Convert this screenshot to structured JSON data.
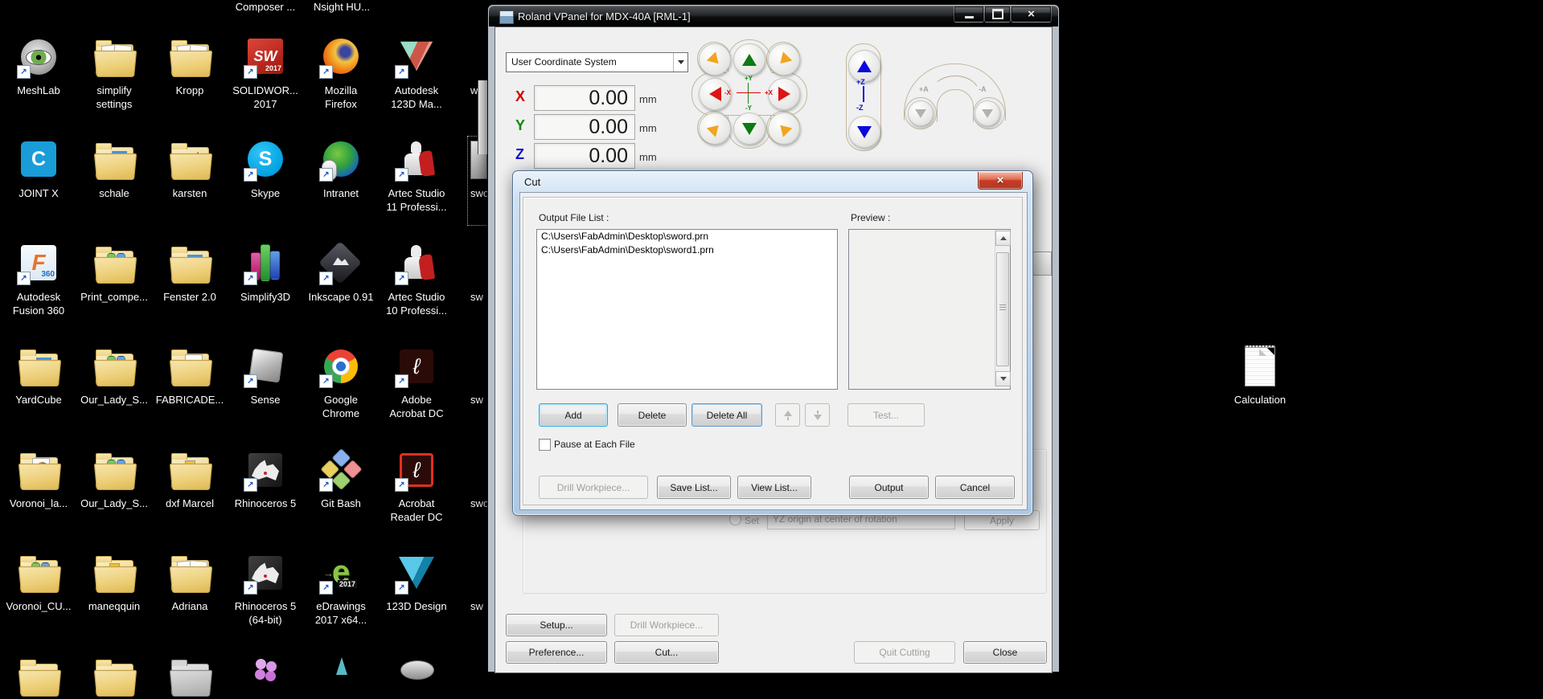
{
  "desktop": {
    "top_partial_labels": [
      "Composer ...",
      "Nsight HU..."
    ],
    "rows": [
      [
        {
          "label": "MeshLab",
          "type": "meshlab",
          "badge": true
        },
        {
          "label": "simplify\nsettings",
          "type": "folder-docs"
        },
        {
          "label": "Kropp",
          "type": "folder-docs"
        },
        {
          "label": "SOLIDWOR...\n2017",
          "type": "sw",
          "glyph": "SW",
          "badge_text": "2017",
          "badge": true
        },
        {
          "label": "Mozilla\nFirefox",
          "type": "firefox",
          "badge": true
        },
        {
          "label": "Autodesk\n123D Ma...",
          "type": "a123d",
          "badge": true
        }
      ],
      [
        {
          "label": "JOINT X",
          "type": "letter",
          "glyph": "C"
        },
        {
          "label": "schale",
          "type": "folder-blue"
        },
        {
          "label": "karsten",
          "type": "folder-red"
        },
        {
          "label": "Skype",
          "type": "circle-letter",
          "glyph": "S",
          "badge": true
        },
        {
          "label": "Intranet",
          "type": "globe",
          "badge": true
        },
        {
          "label": "Artec Studio\n11 Professi...",
          "type": "artec",
          "badge": true
        }
      ],
      [
        {
          "label": "Autodesk\nFusion 360",
          "type": "fusion",
          "glyph": "F",
          "badge_text": "360",
          "badge": true
        },
        {
          "label": "Print_compe...",
          "type": "folder-gb"
        },
        {
          "label": "Fenster 2.0",
          "type": "folder-blue"
        },
        {
          "label": "Simplify3D",
          "type": "s3d",
          "badge": true
        },
        {
          "label": "Inkscape 0.91",
          "type": "inkscape",
          "badge": true
        },
        {
          "label": "Artec Studio\n10 Professi...",
          "type": "artec",
          "badge": true
        }
      ],
      [
        {
          "label": "YardCube",
          "type": "folder-blue"
        },
        {
          "label": "Our_Lady_S...",
          "type": "folder-gb"
        },
        {
          "label": "FABRICADE...",
          "type": "folder-white"
        },
        {
          "label": "Sense",
          "type": "sense",
          "badge": true
        },
        {
          "label": "Google\nChrome",
          "type": "chrome",
          "badge": true
        },
        {
          "label": "Adobe\nAcrobat DC",
          "type": "acrobat",
          "badge": true
        }
      ],
      [
        {
          "label": "Voronoi_la...",
          "type": "folder-ff"
        },
        {
          "label": "Our_Lady_S...",
          "type": "folder-gb"
        },
        {
          "label": "dxf Marcel",
          "type": "folder-img"
        },
        {
          "label": "Rhinoceros 5",
          "type": "rhino",
          "badge": true
        },
        {
          "label": "Git Bash",
          "type": "git",
          "badge": true
        },
        {
          "label": "Acrobat\nReader DC",
          "type": "reader",
          "badge": true
        }
      ],
      [
        {
          "label": "Voronoi_CU...",
          "type": "folder-gb"
        },
        {
          "label": "maneqquin",
          "type": "folder-img"
        },
        {
          "label": "Adriana",
          "type": "folder-docs"
        },
        {
          "label": "Rhinoceros 5\n(64-bit)",
          "type": "rhino",
          "badge": true
        },
        {
          "label": "eDrawings\n2017 x64...",
          "type": "edraw",
          "glyph": "e",
          "badge_text": "2017",
          "badge": true
        },
        {
          "label": "123D Design",
          "type": "d123",
          "badge": true
        }
      ]
    ],
    "col7_partial_labels": [
      "wo",
      "swo",
      "sw",
      "sw",
      "swo",
      "sw"
    ],
    "bottom_partial_row": [
      "folder",
      "folder",
      "folder-grey",
      "flower",
      "drop",
      "bowl"
    ],
    "calculation_icon": {
      "label": "Calculation",
      "type": "doc"
    }
  },
  "vpanel": {
    "title": "Roland VPanel for MDX-40A [RML-1]",
    "coordinate_system": "User Coordinate System",
    "axes": [
      {
        "axis": "X",
        "value": "0.00",
        "unit": "mm",
        "color": "#d40000"
      },
      {
        "axis": "Y",
        "value": "0.00",
        "unit": "mm",
        "color": "#0a8a0a"
      },
      {
        "axis": "Z",
        "value": "0.00",
        "unit": "mm",
        "color": "#1212cc"
      }
    ],
    "jog": {
      "plus_y": "+Y",
      "minus_y": "-Y",
      "plus_x": "+X",
      "minus_x": "-X",
      "plus_z": "+Z",
      "minus_z": "-Z",
      "plus_a": "+A",
      "minus_a": "-A"
    },
    "set_row": {
      "radio_label": "Set",
      "dropdown_value": "YZ origin at center of rotation",
      "apply_label": "Apply"
    },
    "buttons": {
      "setup": "Setup...",
      "drill_workpiece": "Drill Workpiece...",
      "preference": "Preference...",
      "cut": "Cut...",
      "quit_cutting": "Quit Cutting",
      "close": "Close"
    }
  },
  "cut_dialog": {
    "title": "Cut",
    "output_file_list_label": "Output File List :",
    "files": [
      "C:\\Users\\FabAdmin\\Desktop\\sword.prn",
      "C:\\Users\\FabAdmin\\Desktop\\sword1.prn"
    ],
    "preview_label": "Preview :",
    "pause_checkbox_label": "Pause at Each File",
    "buttons": {
      "add": "Add",
      "delete": "Delete",
      "delete_all": "Delete All",
      "test": "Test...",
      "drill_workpiece": "Drill Workpiece...",
      "save_list": "Save List...",
      "view_list": "View List...",
      "output": "Output",
      "cancel": "Cancel"
    }
  }
}
